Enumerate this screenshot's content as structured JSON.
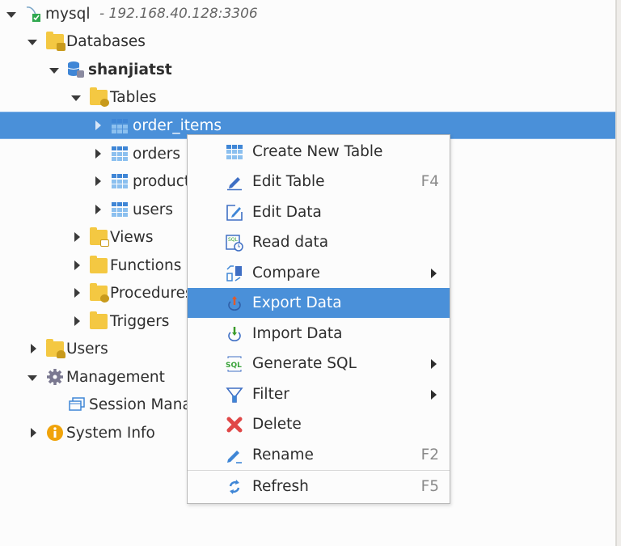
{
  "tree": {
    "connection": {
      "name": "mysql",
      "address": "- 192.168.40.128:3306"
    },
    "nodes": [
      {
        "label": "Databases",
        "icon": "databases-folder-icon",
        "expanded": true
      },
      {
        "label": "shanjiatst",
        "icon": "database-icon",
        "expanded": true
      },
      {
        "label": "Tables",
        "icon": "tables-folder-icon",
        "expanded": true
      },
      {
        "label": "order_items",
        "icon": "table-icon",
        "selected": true
      },
      {
        "label": "orders",
        "icon": "table-icon"
      },
      {
        "label": "products",
        "icon": "table-icon"
      },
      {
        "label": "users",
        "icon": "table-icon"
      },
      {
        "label": "Views",
        "icon": "views-folder-icon"
      },
      {
        "label": "Functions",
        "icon": "functions-folder-icon"
      },
      {
        "label": "Procedures",
        "icon": "procedures-folder-icon"
      },
      {
        "label": "Triggers",
        "icon": "triggers-folder-icon"
      },
      {
        "label": "Users",
        "icon": "users-folder-icon"
      },
      {
        "label": "Management",
        "icon": "gear-icon",
        "expanded": true
      },
      {
        "label": "Session Manager",
        "icon": "session-manager-icon"
      },
      {
        "label": "System Info",
        "icon": "info-icon"
      }
    ]
  },
  "context_menu": {
    "items": [
      {
        "label": "Create New Table",
        "icon": "create-table-icon"
      },
      {
        "label": "Edit Table",
        "shortcut": "F4",
        "icon": "pencil-icon"
      },
      {
        "label": "Edit Data",
        "icon": "edit-data-icon"
      },
      {
        "label": "Read data",
        "icon": "read-data-icon"
      },
      {
        "label": "Compare",
        "icon": "compare-icon",
        "submenu": true
      },
      {
        "label": "Export Data",
        "icon": "export-icon",
        "highlighted": true
      },
      {
        "label": "Import Data",
        "icon": "import-icon"
      },
      {
        "label": "Generate SQL",
        "icon": "sql-icon",
        "submenu": true
      },
      {
        "label": "Filter",
        "icon": "filter-icon",
        "submenu": true
      },
      {
        "label": "Delete",
        "icon": "delete-icon"
      },
      {
        "label": "Rename",
        "shortcut": "F2",
        "icon": "rename-icon"
      },
      {
        "label": "Refresh",
        "shortcut": "F5",
        "icon": "refresh-icon"
      }
    ]
  },
  "colors": {
    "selection": "#4a90d9",
    "folder": "#f4c842",
    "table": "#3f86d6"
  }
}
